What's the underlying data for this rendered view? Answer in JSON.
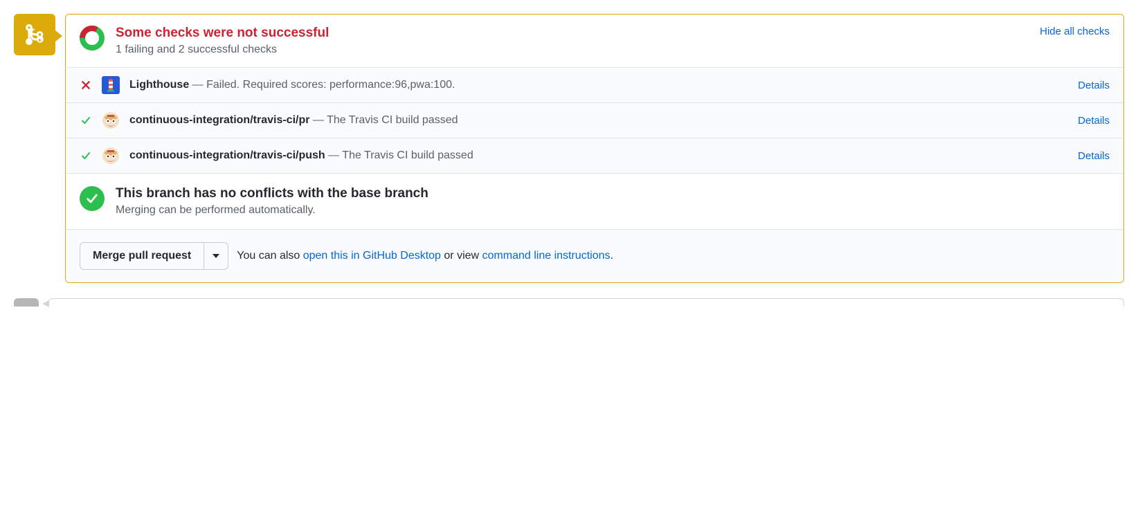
{
  "header": {
    "title": "Some checks were not successful",
    "subtitle": "1 failing and 2 successful checks",
    "hide_link": "Hide all checks",
    "failing_fraction": 0.33
  },
  "checks": [
    {
      "status": "fail",
      "app": "lighthouse",
      "context": "Lighthouse",
      "message": "Failed. Required scores: performance:96,pwa:100.",
      "action": "Details"
    },
    {
      "status": "pass",
      "app": "travis",
      "context": "continuous-integration/travis-ci/pr",
      "message": "The Travis CI build passed",
      "action": "Details"
    },
    {
      "status": "pass",
      "app": "travis",
      "context": "continuous-integration/travis-ci/push",
      "message": "The Travis CI build passed",
      "action": "Details"
    }
  ],
  "conflicts": {
    "title": "This branch has no conflicts with the base branch",
    "subtitle": "Merging can be performed automatically."
  },
  "merge": {
    "button": "Merge pull request",
    "hint_prefix": "You can also ",
    "link1": "open this in GitHub Desktop",
    "hint_middle": " or view ",
    "link2": "command line instructions",
    "hint_suffix": "."
  }
}
